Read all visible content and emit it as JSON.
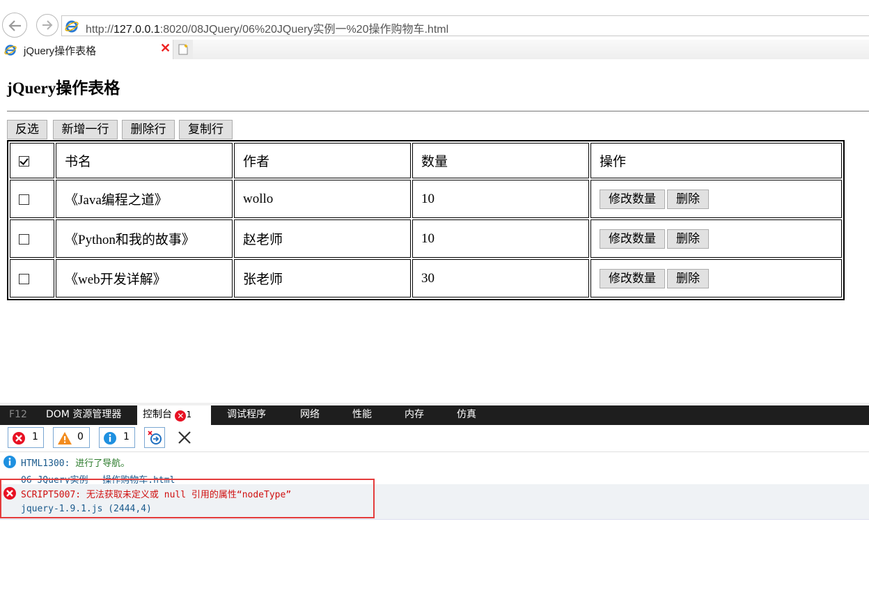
{
  "browser": {
    "url_prefix": "http://",
    "url_host": "127.0.0.1",
    "url_rest": ":8020/08JQuery/06%20JQuery实例一%20操作购物车.html",
    "tab_title": "jQuery操作表格",
    "tab_close": "✕"
  },
  "page": {
    "heading": "jQuery操作表格",
    "buttons": [
      "反选",
      "新增一行",
      "删除行",
      "复制行"
    ],
    "table": {
      "headers": [
        "书名",
        "作者",
        "数量",
        "操作"
      ],
      "header_checked": true,
      "rows": [
        {
          "title": "《Java编程之道》",
          "author": "wollo",
          "qty": "10",
          "checked": false
        },
        {
          "title": "《Python和我的故事》",
          "author": "赵老师",
          "qty": "10",
          "checked": false
        },
        {
          "title": "《web开发详解》",
          "author": "张老师",
          "qty": "30",
          "checked": false
        }
      ],
      "row_buttons": {
        "edit": "修改数量",
        "delete": "删除"
      }
    }
  },
  "devtools": {
    "tabs": [
      "F12",
      "DOM 资源管理器",
      "控制台",
      "调试程序",
      "网络",
      "性能",
      "内存",
      "仿真"
    ],
    "console_error_count": "1",
    "filters": {
      "errors": "1",
      "warnings": "0",
      "info": "1"
    },
    "messages": {
      "info_code": "HTML1300: ",
      "info_text": "进行了导航。",
      "info_source": "06 JQuery实例一 操作购物车.html",
      "error_text": "SCRIPT5007: 无法获取未定义或 null 引用的属性“nodeType”",
      "error_source": "jquery-1.9.1.js (2444,4)"
    },
    "colors": {
      "error": "#e81123",
      "warning": "#f28c1f",
      "info": "#1e90e0",
      "highlight": "#e43c3c"
    }
  }
}
